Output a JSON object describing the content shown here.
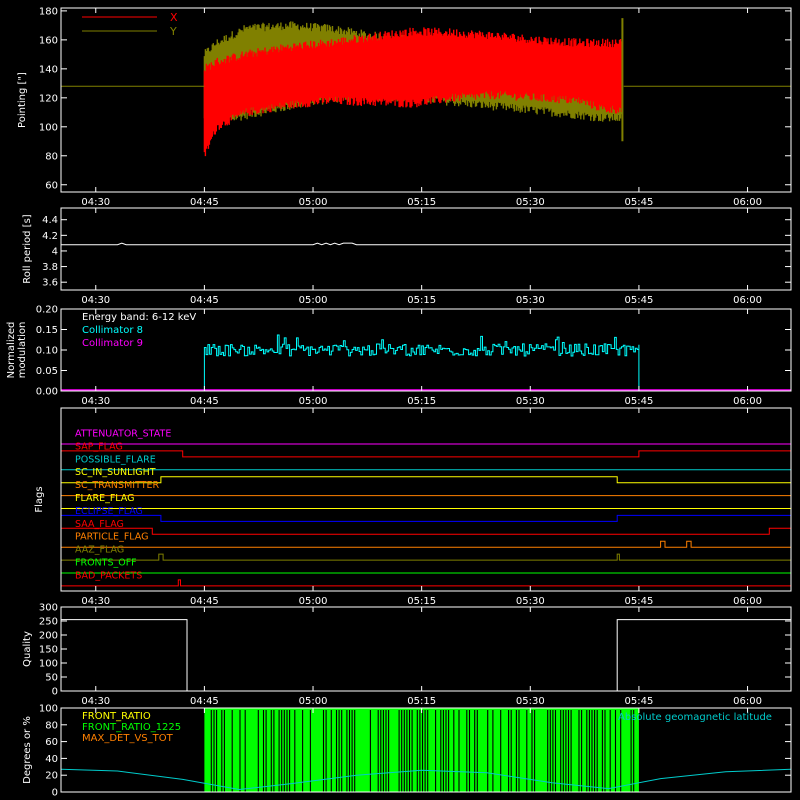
{
  "chart_data": [
    {
      "id": "pointing",
      "type": "line",
      "ylabel": "Pointing [\"]",
      "ylim": [
        55,
        182
      ],
      "yticks": [
        60,
        80,
        100,
        120,
        140,
        160,
        180
      ],
      "xticks": [
        "04:30",
        "04:45",
        "05:00",
        "05:15",
        "05:30",
        "05:45",
        "06:00"
      ],
      "reference_line": 128,
      "series": [
        {
          "name": "X",
          "color": "#ff0000",
          "envelope_min": [
            [
              0.0,
              80
            ],
            [
              0.3,
              100
            ],
            [
              1.0,
              110
            ],
            [
              2.0,
              115
            ],
            [
              3.0,
              118
            ],
            [
              4.0,
              117
            ],
            [
              5.0,
              116
            ],
            [
              6.0,
              120
            ],
            [
              7.0,
              122
            ],
            [
              8.0,
              120
            ],
            [
              9.0,
              118
            ],
            [
              9.6,
              112
            ]
          ],
          "envelope_max": [
            [
              0.0,
              140
            ],
            [
              0.3,
              145
            ],
            [
              1.0,
              150
            ],
            [
              2.0,
              155
            ],
            [
              3.0,
              158
            ],
            [
              4.0,
              162
            ],
            [
              5.0,
              166
            ],
            [
              6.0,
              165
            ],
            [
              7.0,
              163
            ],
            [
              8.0,
              160
            ],
            [
              9.0,
              158
            ],
            [
              9.6,
              158
            ]
          ]
        },
        {
          "name": "Y",
          "color": "#808000",
          "envelope_min": [
            [
              0.0,
              105
            ],
            [
              0.3,
              103
            ],
            [
              1.0,
              108
            ],
            [
              2.0,
              114
            ],
            [
              3.0,
              119
            ],
            [
              4.0,
              121
            ],
            [
              5.0,
              120
            ],
            [
              6.0,
              117
            ],
            [
              7.0,
              114
            ],
            [
              8.0,
              111
            ],
            [
              9.0,
              108
            ],
            [
              9.6,
              106
            ]
          ],
          "envelope_max": [
            [
              0.0,
              150
            ],
            [
              0.3,
              158
            ],
            [
              1.0,
              168
            ],
            [
              2.0,
              170
            ],
            [
              3.0,
              168
            ],
            [
              4.0,
              163
            ],
            [
              5.0,
              160
            ],
            [
              6.0,
              155
            ],
            [
              7.0,
              153
            ],
            [
              8.0,
              151
            ],
            [
              9.0,
              150
            ],
            [
              9.6,
              150
            ]
          ]
        }
      ]
    },
    {
      "id": "roll",
      "type": "line",
      "ylabel": "Roll period [s]",
      "ylim": [
        3.5,
        4.55
      ],
      "yticks": [
        3.6,
        3.8,
        4.0,
        4.2,
        4.4
      ],
      "xticks": [
        "04:30",
        "04:45",
        "05:00",
        "05:15",
        "05:30",
        "05:45",
        "06:00"
      ],
      "series": [
        {
          "name": "",
          "color": "#ffffff",
          "values": [
            4.08,
            4.08,
            4.08,
            4.08
          ]
        }
      ]
    },
    {
      "id": "modulation",
      "type": "line",
      "ylabel": "Normalized modulation",
      "ylim": [
        0,
        0.2
      ],
      "yticks": [
        "0.00",
        "0.05",
        "0.10",
        "0.15",
        "0.20"
      ],
      "xticks": [
        "04:30",
        "04:45",
        "05:00",
        "05:15",
        "05:30",
        "05:45",
        "06:00"
      ],
      "annotation": "Energy band: 6-12 keV",
      "series": [
        {
          "name": "Collimator 8",
          "color": "#00ffff",
          "baseline": 0.1,
          "range_hours": [
            4.75,
            5.75
          ]
        },
        {
          "name": "Collimator 9",
          "color": "#ff00ff",
          "baseline": 0.0
        }
      ]
    },
    {
      "id": "flags",
      "type": "line",
      "ylabel": "Flags",
      "xticks": [
        "04:30",
        "04:45",
        "05:00",
        "05:15",
        "05:30",
        "05:45",
        "06:00"
      ],
      "series": [
        {
          "name": "ATTENUATOR_STATE",
          "color": "#ff00ff",
          "steps": [
            [
              4.42,
              0
            ]
          ]
        },
        {
          "name": "SAP_FLAG",
          "color": "#ff0000",
          "steps": [
            [
              4.42,
              1
            ],
            [
              4.7,
              0
            ],
            [
              5.75,
              1
            ]
          ]
        },
        {
          "name": "POSSIBLE_FLARE",
          "color": "#00cccc",
          "steps": [
            [
              4.42,
              0
            ]
          ]
        },
        {
          "name": "SC_IN_SUNLIGHT",
          "color": "#ffff00",
          "steps": [
            [
              4.42,
              0
            ],
            [
              4.65,
              1
            ],
            [
              5.7,
              0
            ]
          ]
        },
        {
          "name": "SC_TRANSMITTER",
          "color": "#ff8000",
          "steps": [
            [
              4.42,
              0
            ]
          ]
        },
        {
          "name": "FLARE_FLAG",
          "color": "#ffff00",
          "steps": [
            [
              4.42,
              0
            ]
          ]
        },
        {
          "name": "ECLIPSE_FLAG",
          "color": "#0000ff",
          "steps": [
            [
              4.42,
              1
            ],
            [
              4.65,
              0
            ],
            [
              5.7,
              1
            ]
          ]
        },
        {
          "name": "SAA_FLAG",
          "color": "#ff0000",
          "steps": [
            [
              4.42,
              1
            ],
            [
              4.63,
              0
            ],
            [
              6.05,
              1
            ]
          ]
        },
        {
          "name": "PARTICLE_FLAG",
          "color": "#ff8000",
          "steps": [
            [
              4.42,
              0
            ],
            [
              5.8,
              1
            ],
            [
              5.81,
              0
            ],
            [
              5.86,
              1
            ],
            [
              5.87,
              0
            ]
          ]
        },
        {
          "name": "AAZ_FLAG",
          "color": "#808000",
          "steps": [
            [
              4.42,
              0
            ],
            [
              4.645,
              1
            ],
            [
              4.655,
              0
            ],
            [
              5.7,
              1
            ],
            [
              5.705,
              0
            ]
          ]
        },
        {
          "name": "FRONTS_OFF",
          "color": "#00ff00",
          "steps": [
            [
              4.42,
              0
            ]
          ]
        },
        {
          "name": "BAD_PACKETS",
          "color": "#ff0000",
          "steps": [
            [
              4.42,
              0
            ],
            [
              4.69,
              1
            ],
            [
              4.695,
              0
            ]
          ]
        }
      ]
    },
    {
      "id": "quality",
      "type": "line",
      "ylabel": "Quality",
      "ylim": [
        0,
        300
      ],
      "yticks": [
        0,
        50,
        100,
        150,
        200,
        250,
        300
      ],
      "xticks": [
        "04:30",
        "04:45",
        "05:00",
        "05:15",
        "05:30",
        "05:45",
        "06:00"
      ],
      "series": [
        {
          "name": "",
          "color": "#ffffff",
          "steps": [
            [
              4.42,
              255
            ],
            [
              4.71,
              0
            ],
            [
              5.7,
              255
            ]
          ]
        }
      ]
    },
    {
      "id": "ratios",
      "type": "line",
      "ylabel": "Degrees or %",
      "ylim": [
        0,
        100
      ],
      "yticks": [
        0,
        20,
        40,
        60,
        80,
        100
      ],
      "series": [
        {
          "name": "FRONT_RATIO",
          "color": "#ffff00"
        },
        {
          "name": "FRONT_RATIO_1225",
          "color": "#00ff00",
          "range_hours": [
            4.75,
            5.75
          ],
          "value": 100
        },
        {
          "name": "MAX_DET_VS_TOT",
          "color": "#ff8000"
        },
        {
          "name": "Absolute geomagnetic latitude",
          "color": "#00cccc",
          "points": [
            [
              4.42,
              27
            ],
            [
              4.55,
              25
            ],
            [
              4.7,
              15
            ],
            [
              4.83,
              3
            ],
            [
              4.95,
              10
            ],
            [
              5.1,
              20
            ],
            [
              5.25,
              26
            ],
            [
              5.4,
              23
            ],
            [
              5.55,
              11
            ],
            [
              5.68,
              4
            ],
            [
              5.8,
              16
            ],
            [
              5.95,
              24
            ],
            [
              6.1,
              27
            ]
          ]
        }
      ]
    }
  ]
}
